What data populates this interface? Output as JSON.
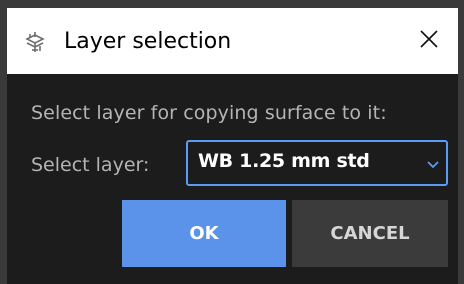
{
  "window": {
    "title": "Layer selection",
    "close_icon": "close-icon",
    "title_icon": "layer-copy-icon"
  },
  "dialog": {
    "prompt": "Select layer for copying surface to it:",
    "select_label": "Select layer:",
    "layer_select": {
      "value": "WB 1.25 mm std",
      "icon": "chevron-down-icon"
    },
    "ok_label": "OK",
    "cancel_label": "CANCEL"
  },
  "colors": {
    "background": "#1c1c1c",
    "accent": "#5b93ea",
    "titlebar": "#ffffff",
    "text_muted": "#b4b4b4",
    "cancel_bg": "#3b3b3b"
  }
}
